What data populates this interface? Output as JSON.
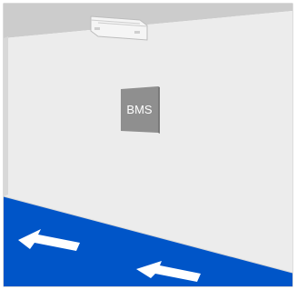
{
  "bms_box": {
    "label": "BMS"
  },
  "colors": {
    "ceiling": "#cccccc",
    "wall": "#ececec",
    "floor": "#0055c8",
    "bms_panel": "#8f8f8f",
    "arrow": "#ffffff",
    "frame": "#b9b9b9"
  },
  "icons": {
    "ceiling_device": "ceiling-unit-icon",
    "floor_arrows": "left-arrow-icon"
  }
}
